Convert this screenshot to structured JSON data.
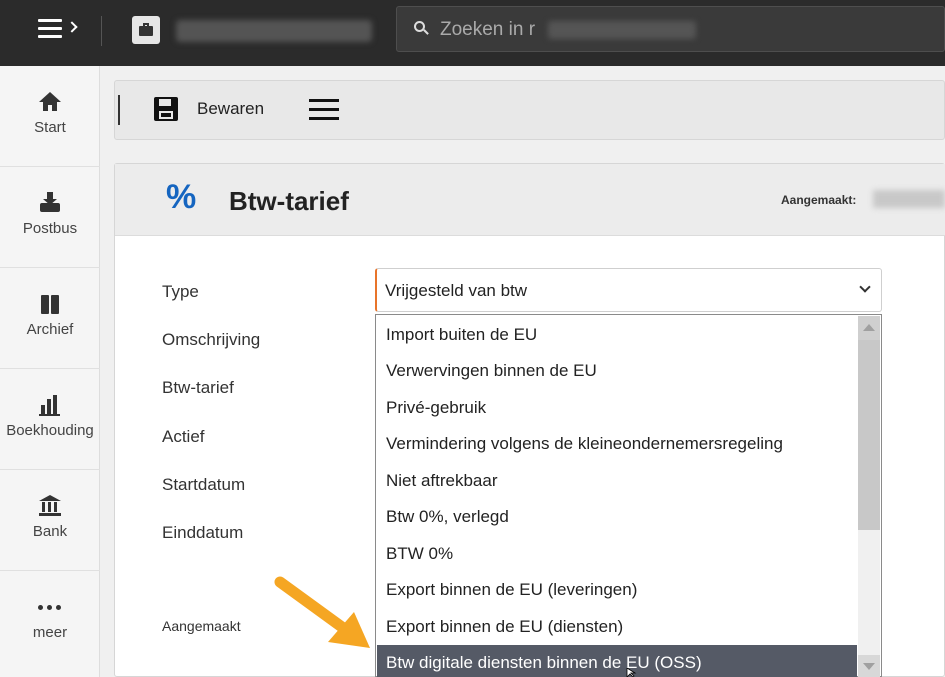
{
  "topbar": {
    "search_placeholder": "Zoeken in r"
  },
  "sidebar": {
    "items": [
      {
        "label": "Start",
        "icon": "home-icon"
      },
      {
        "label": "Postbus",
        "icon": "inbox-icon"
      },
      {
        "label": "Archief",
        "icon": "archive-icon"
      },
      {
        "label": "Boekhouding",
        "icon": "bar-chart-icon"
      },
      {
        "label": "Bank",
        "icon": "bank-icon"
      },
      {
        "label": "meer",
        "icon": "more-dots-icon"
      }
    ]
  },
  "toolbar": {
    "save_label": "Bewaren"
  },
  "page": {
    "icon_glyph": "%",
    "title": "Btw-tarief",
    "created_label": "Aangemaakt:"
  },
  "form": {
    "labels": [
      "Type",
      "Omschrijving",
      "Btw-tarief",
      "Actief",
      "Startdatum",
      "Einddatum"
    ],
    "footer_label": "Aangemaakt",
    "type_value": "Vrijgesteld van btw"
  },
  "dropdown": {
    "options": [
      "Import buiten de EU",
      "Verwervingen binnen de EU",
      "Privé-gebruik",
      "Vermindering volgens de kleineondernemersregeling",
      "Niet aftrekbaar",
      "Btw 0%, verlegd",
      "BTW 0%",
      "Export binnen de EU (leveringen)",
      "Export binnen de EU (diensten)",
      "Btw digitale diensten binnen de EU (OSS)"
    ],
    "highlighted_index": 9
  },
  "colors": {
    "topbar": "#2b2b2b",
    "accent_percent": "#1565c0",
    "select_accent": "#e8742a",
    "highlight": "#555a66",
    "annotation_arrow": "#f5a623"
  }
}
